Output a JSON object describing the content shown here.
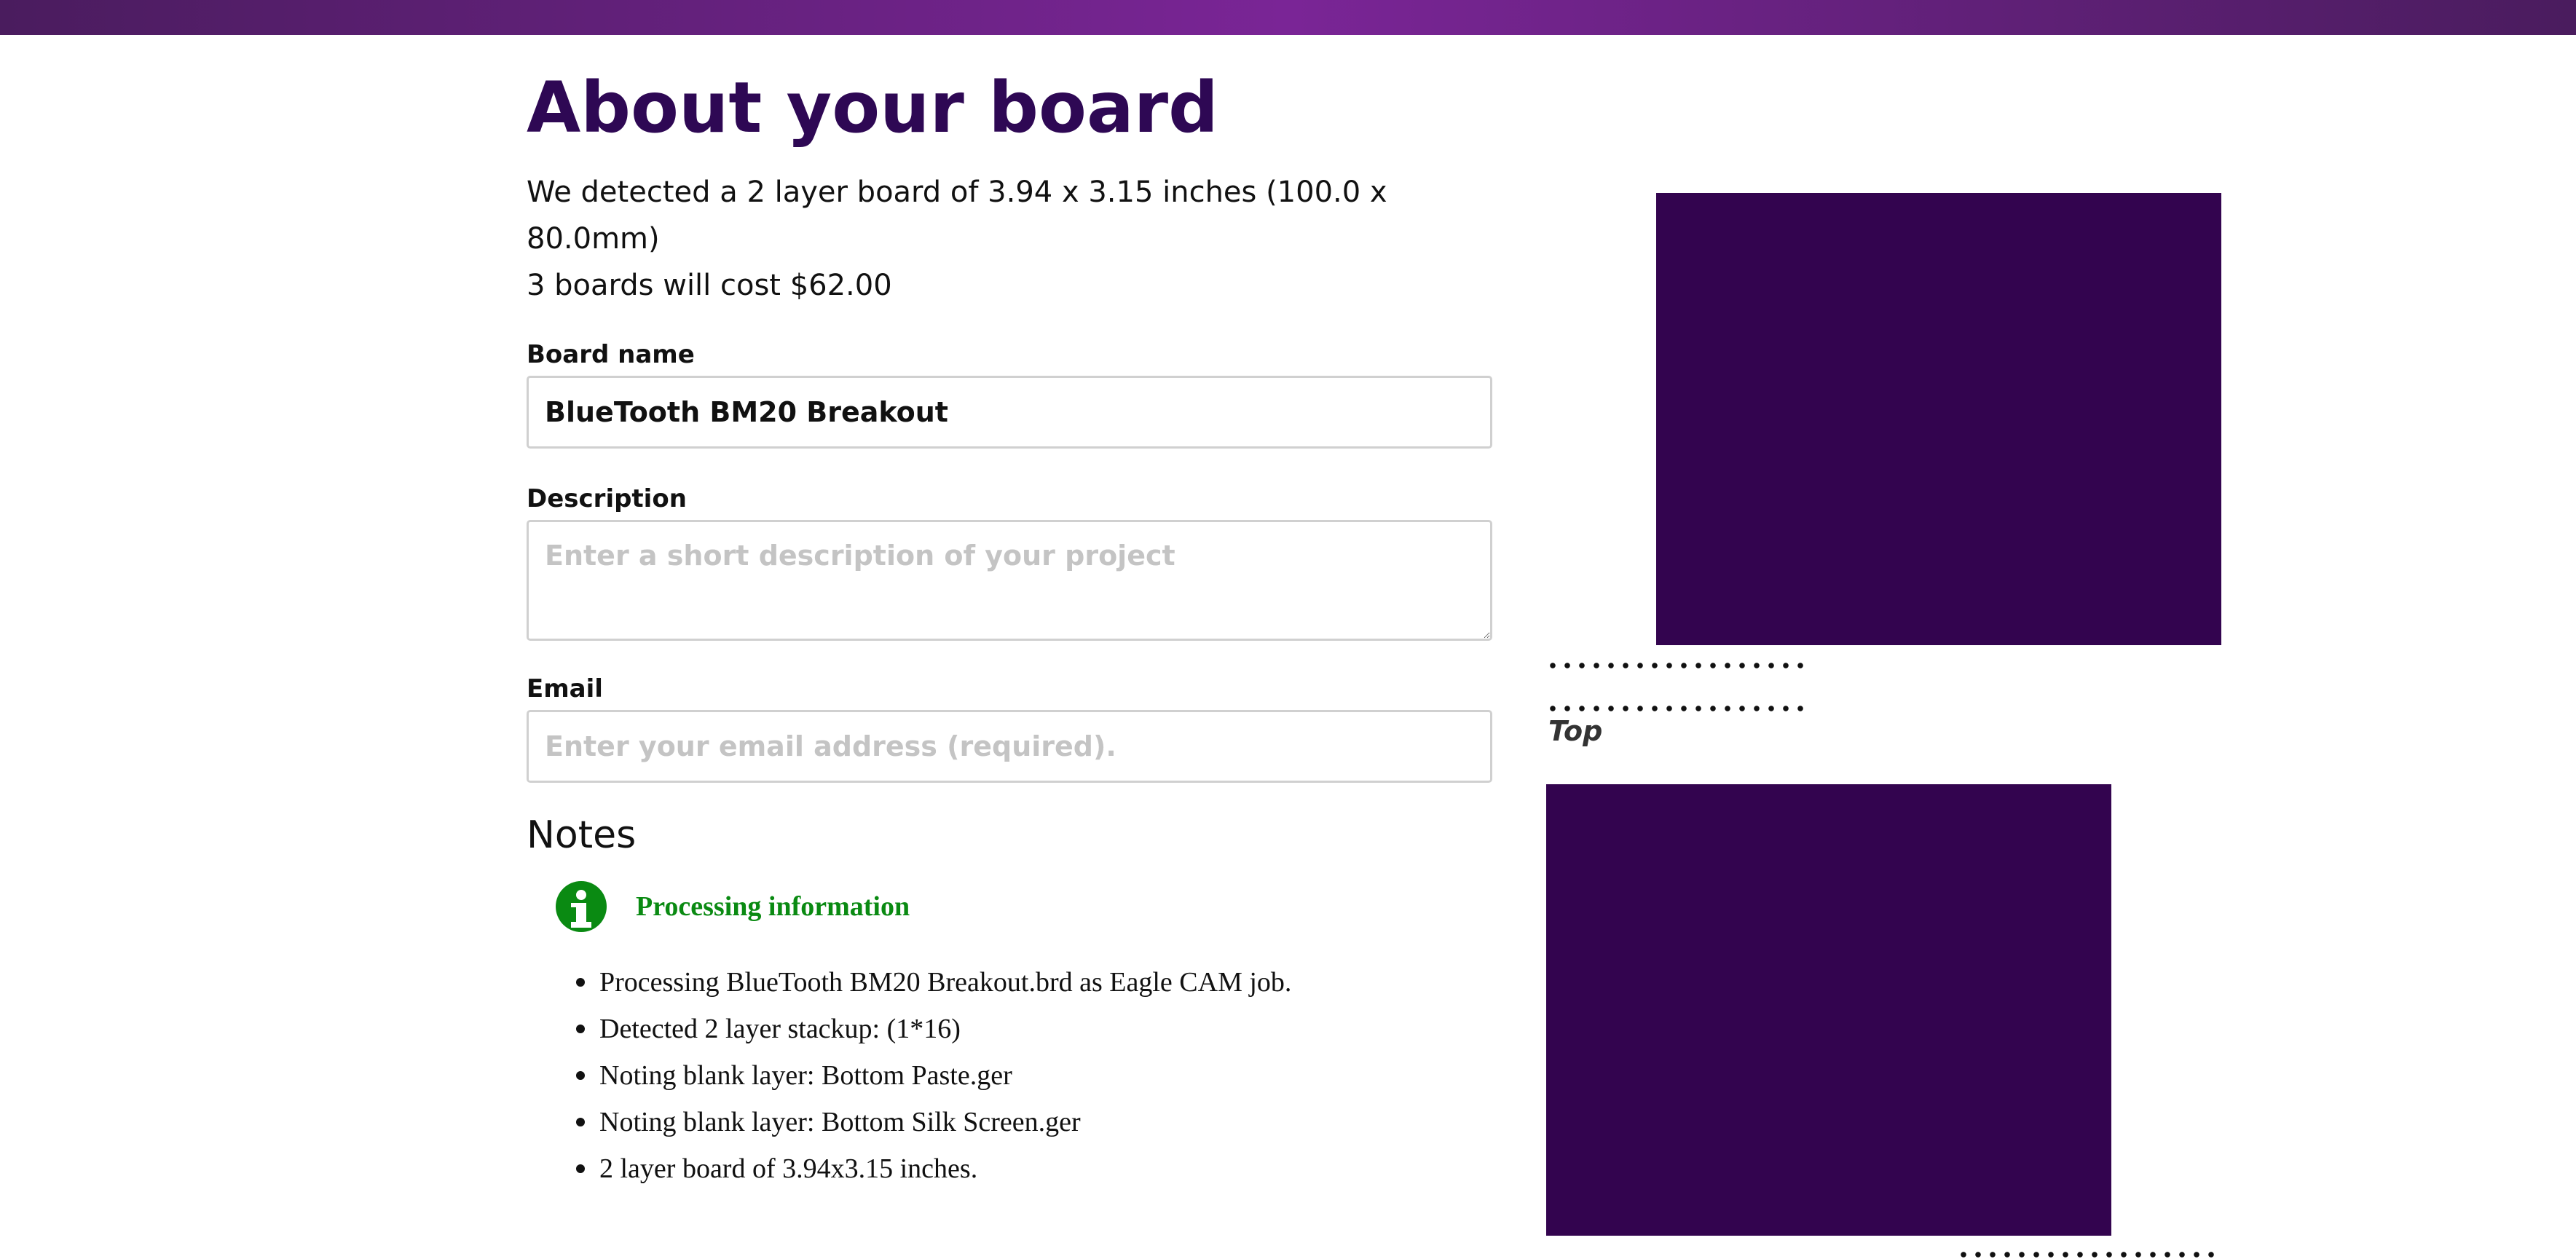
{
  "header": {
    "title": "About your board",
    "detected_text": "We detected a 2 layer board of 3.94 x 3.15 inches (100.0 x 80.0mm)",
    "cost_text": "3 boards will cost $62.00"
  },
  "form": {
    "board_name_label": "Board name",
    "board_name_value": "BlueTooth BM20 Breakout",
    "description_label": "Description",
    "description_placeholder": "Enter a short description of your project",
    "email_label": "Email",
    "email_placeholder": "Enter your email address (required)."
  },
  "notes": {
    "heading": "Notes",
    "info_title": "Processing information",
    "items": [
      "Processing BlueTooth BM20 Breakout.brd as Eagle CAM job.",
      "Detected 2 layer stackup: (1*16)",
      "Noting blank layer: Bottom Paste.ger",
      "Noting blank layer: Bottom Silk Screen.ger",
      "2 layer board of 3.94x3.15 inches."
    ]
  },
  "preview": {
    "top_label": "Top",
    "board_color": "#33044f"
  },
  "colors": {
    "brand": "#7a2596",
    "title": "#2e0854",
    "info": "#0a8a12"
  }
}
